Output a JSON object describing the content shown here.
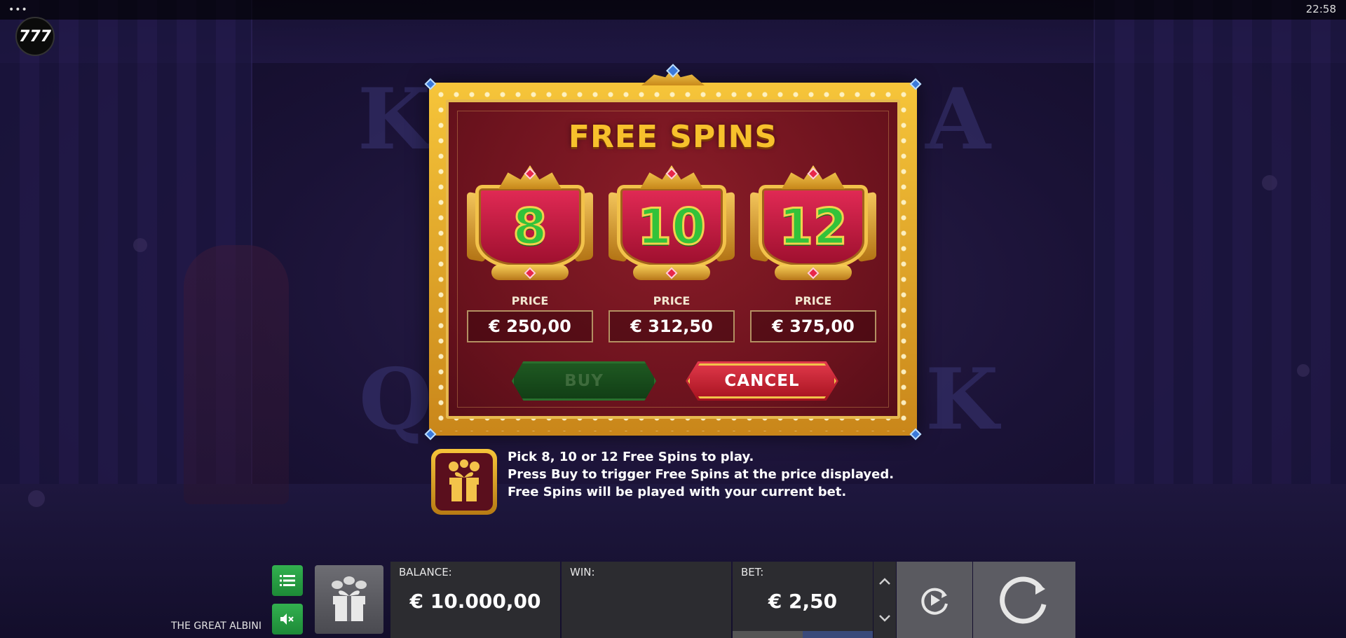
{
  "topbar": {
    "clock": "22:58",
    "menu_glyph": "•••"
  },
  "logo": {
    "text": "777"
  },
  "modal": {
    "title": "FREE SPINS",
    "options": [
      {
        "spins": "8",
        "price_label": "PRICE",
        "price": "€ 250,00"
      },
      {
        "spins": "10",
        "price_label": "PRICE",
        "price": "€ 312,50"
      },
      {
        "spins": "12",
        "price_label": "PRICE",
        "price": "€ 375,00"
      }
    ],
    "buy_label": "BUY",
    "cancel_label": "CANCEL"
  },
  "info": {
    "lines": [
      "Pick 8, 10 or 12 Free Spins to play.",
      "Press Buy to trigger Free Spins at the price displayed.",
      "Free Spins will be played with your current bet."
    ]
  },
  "controls": {
    "game_name": "THE GREAT ALBINI",
    "balance_label": "BALANCE:",
    "balance_value": "€ 10.000,00",
    "win_label": "WIN:",
    "win_value": "",
    "bet_label": "BET:",
    "bet_value": "€ 2,50",
    "bet_level_fraction": 0.5
  },
  "colors": {
    "accent_gold": "#f7c12c",
    "buy_green": "#1f5a22",
    "cancel_red": "#e33a4c",
    "spin_number_green": "#33c23a",
    "control_green": "#32b04f"
  },
  "icons": {
    "menu": "list-icon",
    "sound": "mute-icon",
    "gift": "gift-icon",
    "autoplay": "autoplay-icon",
    "spin": "spin-icon"
  }
}
